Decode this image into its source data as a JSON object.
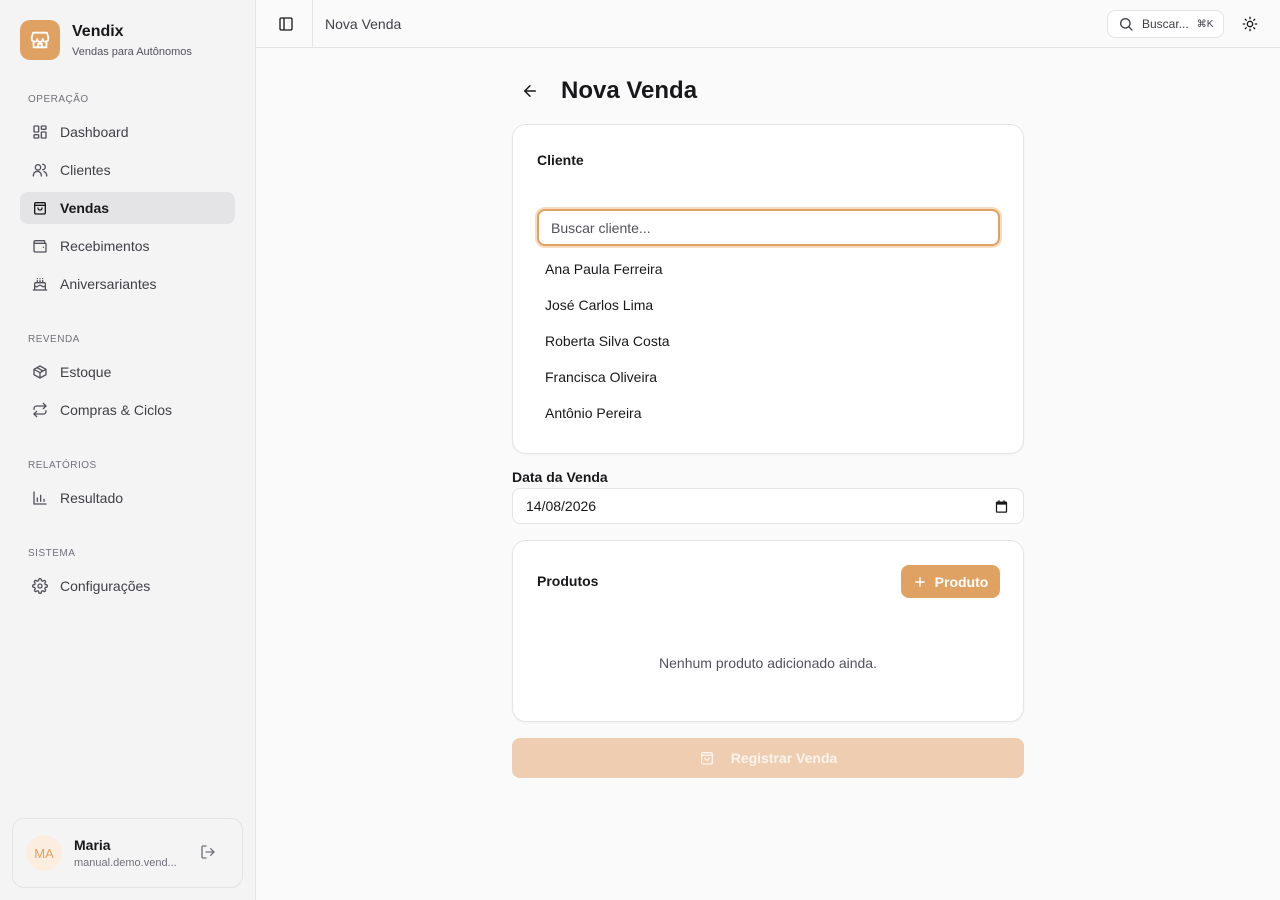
{
  "brand": {
    "name": "Vendix",
    "subtitle": "Vendas para Autônomos",
    "accent": "#e0a263"
  },
  "sidebar": {
    "groups": [
      {
        "label": "OPERAÇÃO",
        "items": [
          {
            "label": "Dashboard",
            "icon": "dashboard-icon"
          },
          {
            "label": "Clientes",
            "icon": "users-icon"
          },
          {
            "label": "Vendas",
            "icon": "shopping-bag-icon",
            "active": true
          },
          {
            "label": "Recebimentos",
            "icon": "wallet-icon"
          },
          {
            "label": "Aniversariantes",
            "icon": "cake-icon"
          }
        ]
      },
      {
        "label": "REVENDA",
        "items": [
          {
            "label": "Estoque",
            "icon": "package-icon"
          },
          {
            "label": "Compras & Ciclos",
            "icon": "repeat-icon"
          }
        ]
      },
      {
        "label": "RELATÓRIOS",
        "items": [
          {
            "label": "Resultado",
            "icon": "bar-chart-icon"
          }
        ]
      },
      {
        "label": "SISTEMA",
        "items": [
          {
            "label": "Configurações",
            "icon": "gear-icon"
          }
        ]
      }
    ]
  },
  "user": {
    "initials": "MA",
    "name": "Maria",
    "email": "manual.demo.vend..."
  },
  "header": {
    "page": "Nova Venda",
    "search_label": "Buscar...",
    "shortcut": "⌘K"
  },
  "main": {
    "title": "Nova Venda",
    "client_card": {
      "title": "Cliente",
      "search_placeholder": "Buscar cliente...",
      "clients": [
        "Ana Paula Ferreira",
        "José Carlos Lima",
        "Roberta Silva Costa",
        "Francisca Oliveira",
        "Antônio Pereira"
      ]
    },
    "date": {
      "label": "Data da Venda",
      "value": "14/08/2026"
    },
    "products_card": {
      "title": "Produtos",
      "add_label": "Produto",
      "empty": "Nenhum produto adicionado ainda."
    },
    "submit_label": "Registrar Venda"
  }
}
